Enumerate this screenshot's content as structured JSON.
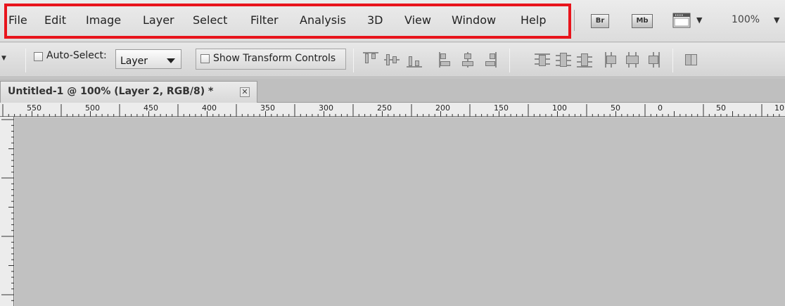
{
  "menu": {
    "items": [
      "File",
      "Edit",
      "Image",
      "Layer",
      "Select",
      "Filter",
      "Analysis",
      "3D",
      "View",
      "Window",
      "Help"
    ]
  },
  "launch_buttons": {
    "bridge": "Br",
    "minibridge": "Mb"
  },
  "zoom": "100%",
  "options": {
    "auto_select_label": "Auto-Select:",
    "auto_select_value": "Layer",
    "show_transform_label": "Show Transform Controls",
    "align_icons": [
      "align-top-icon",
      "align-vertical-center-icon",
      "align-bottom-icon",
      "align-left-icon",
      "align-horizontal-center-icon",
      "align-right-icon",
      "distribute-top-icon",
      "distribute-vertical-center-icon",
      "distribute-bottom-icon",
      "distribute-left-icon",
      "distribute-horizontal-center-icon",
      "distribute-right-icon",
      "auto-align-layers-icon"
    ]
  },
  "document": {
    "tab_title": "Untitled-1 @ 100% (Layer 2, RGB/8) *",
    "close_glyph": "✕"
  },
  "ruler": {
    "labels": [
      "550",
      "500",
      "450",
      "400",
      "350",
      "300",
      "250",
      "200",
      "150",
      "100",
      "50",
      "0",
      "50",
      "10"
    ]
  },
  "colors": {
    "highlight": "#e8141c",
    "canvas": "#c1c1c1"
  }
}
